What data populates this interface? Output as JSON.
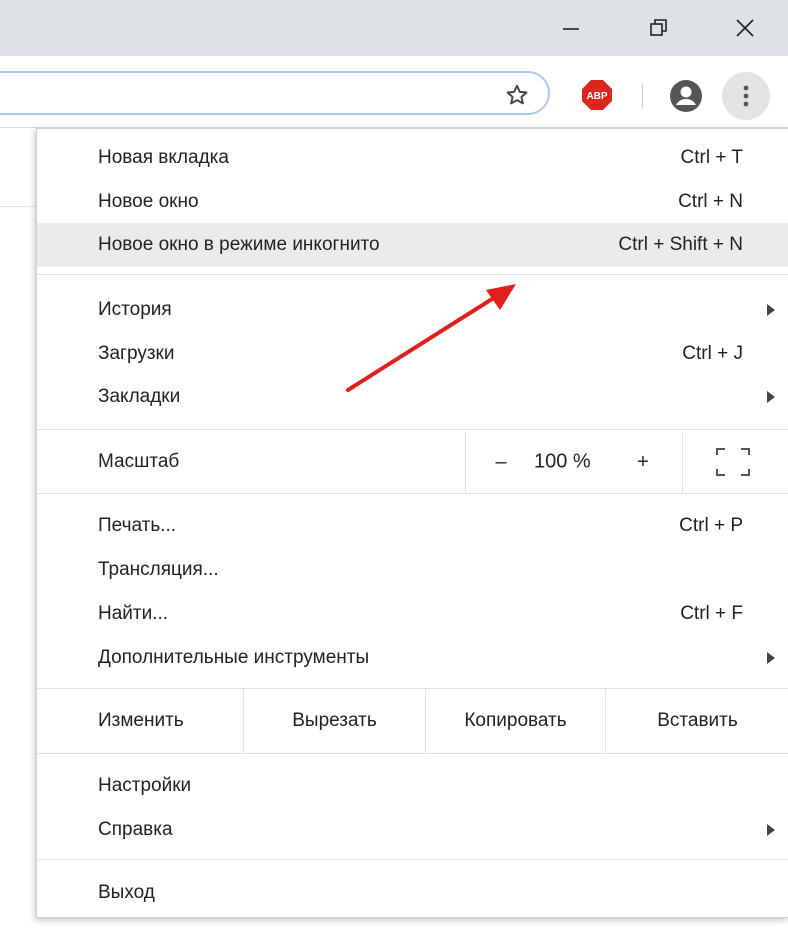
{
  "window_controls": {
    "minimize_icon": "minimize-icon",
    "maximize_icon": "restore-icon",
    "close_icon": "close-icon"
  },
  "toolbar": {
    "omnibox_value": "",
    "bookmark_icon": "star-icon",
    "extension_label": "ABP",
    "extension_color": "#d9271e",
    "profile_icon": "account-circle-icon",
    "menu_icon": "kebab-menu-icon"
  },
  "menu": {
    "group1": [
      {
        "label": "Новая вкладка",
        "shortcut": "Ctrl + T"
      },
      {
        "label": "Новое окно",
        "shortcut": "Ctrl + N"
      },
      {
        "label": "Новое окно в режиме инкогнито",
        "shortcut": "Ctrl + Shift + N",
        "highlighted": true
      }
    ],
    "group2": [
      {
        "label": "История",
        "shortcut": "",
        "submenu": true
      },
      {
        "label": "Загрузки",
        "shortcut": "Ctrl + J"
      },
      {
        "label": "Закладки",
        "shortcut": "",
        "submenu": true
      }
    ],
    "zoom": {
      "label": "Масштаб",
      "minus": "–",
      "value": "100 %",
      "plus": "+",
      "fullscreen_icon": "fullscreen-icon"
    },
    "group3": [
      {
        "label": "Печать...",
        "shortcut": "Ctrl + P"
      },
      {
        "label": "Трансляция...",
        "shortcut": ""
      },
      {
        "label": "Найти...",
        "shortcut": "Ctrl + F"
      },
      {
        "label": "Дополнительные инструменты",
        "shortcut": "",
        "submenu": true
      }
    ],
    "edit": {
      "label": "Изменить",
      "cut": "Вырезать",
      "copy": "Копировать",
      "paste": "Вставить"
    },
    "group4": [
      {
        "label": "Настройки",
        "shortcut": ""
      },
      {
        "label": "Справка",
        "shortcut": "",
        "submenu": true
      }
    ],
    "group5": [
      {
        "label": "Выход",
        "shortcut": ""
      }
    ]
  },
  "annotation": {
    "type": "arrow",
    "color": "#e0201c",
    "points_to": "Новое окно в режиме инкогнито"
  },
  "colors": {
    "titlebar": "#dee1e6",
    "highlight": "#ebebeb",
    "omnibox_focus": "#a8c7fa"
  }
}
